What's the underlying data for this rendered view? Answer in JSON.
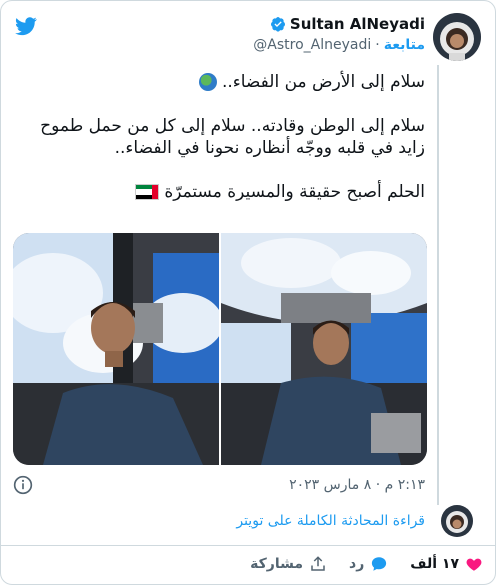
{
  "author": {
    "name": "Sultan AlNeyadi",
    "handle": "@Astro_Alneyadi",
    "follow_label": "متابعة",
    "separator": "·"
  },
  "tweet": {
    "line1": "سلام إلى الأرض من الفضاء..",
    "line2": "سلام إلى الوطن وقادته.. سلام إلى كل من حمل طموح زايد في قلبه ووجّه أنظاره نحونا في الفضاء..",
    "line3": "الحلم أصبح حقيقة والمسيرة مستمرّة",
    "timestamp": "٢:١٣ م · ٨ مارس ٢٠٢٣"
  },
  "links": {
    "read_conversation": "قراءة المحادثة الكاملة على تويتر"
  },
  "actions": {
    "likes_count": "١٧ ألف",
    "reply_label": "رد",
    "share_label": "مشاركة"
  },
  "icons": {
    "logo": "twitter-bird-icon",
    "verified": "verified-badge-icon",
    "globe": "globe-emoji-icon",
    "flag": "uae-flag-icon",
    "info": "info-icon",
    "heart": "heart-icon",
    "reply": "speech-bubble-icon",
    "share": "share-upload-icon"
  },
  "colors": {
    "accent": "#1d9bf0",
    "like": "#f91880",
    "text": "#0f1419",
    "muted": "#536471"
  }
}
